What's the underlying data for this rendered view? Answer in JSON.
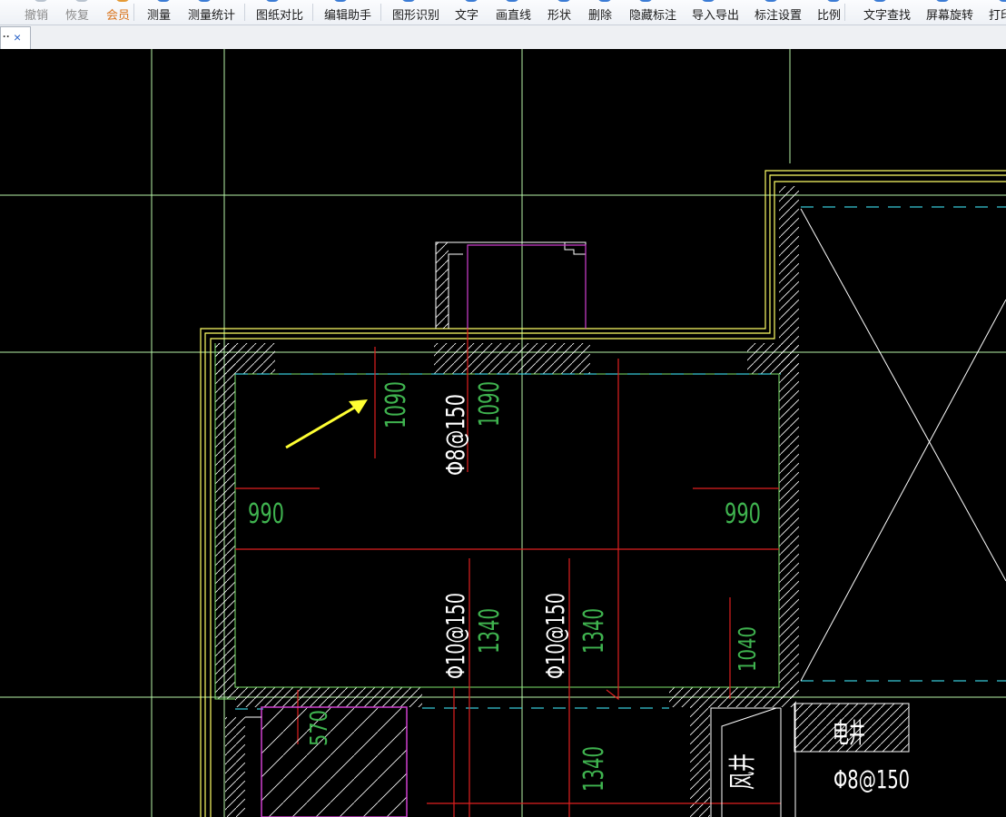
{
  "toolbar": {
    "items": [
      {
        "label": "撤销",
        "state": "disabled"
      },
      {
        "label": "恢复",
        "state": "disabled"
      },
      {
        "label": "会员",
        "state": "vip"
      },
      {
        "label": "测量"
      },
      {
        "label": "测量统计"
      },
      {
        "label": "图纸对比"
      },
      {
        "label": "编辑助手"
      },
      {
        "label": "图形识别"
      },
      {
        "label": "文字"
      },
      {
        "label": "画直线"
      },
      {
        "label": "形状"
      },
      {
        "label": "删除"
      },
      {
        "label": "隐藏标注"
      },
      {
        "label": "导入导出"
      },
      {
        "label": "标注设置"
      },
      {
        "label": "比例"
      },
      {
        "label": "文字查找"
      },
      {
        "label": "屏幕旋转"
      },
      {
        "label": "打印"
      }
    ]
  },
  "tabbar": {
    "tab_dots": "··",
    "close_glyph": "×"
  },
  "drawing": {
    "dim_top_left": "1090",
    "rebar_top": "Φ8@150",
    "dim_top_mid": "1090",
    "dim_left": "990",
    "dim_right": "990",
    "rebar_mid_1": "Φ10@150",
    "dim_mid_1": "1340",
    "rebar_mid_2": "Φ10@150",
    "dim_mid_2": "1340",
    "dim_right_low": "1040",
    "dim_bottom_left": "570",
    "dim_bottom_mid": "1340",
    "label_shaft": "电井",
    "label_wind": "风井",
    "rebar_bottom_right": "Φ8@150",
    "colors": {
      "background": "#000000",
      "wall": "#ffff66",
      "grid": "#b7f5a9",
      "rebar": "#e02020",
      "dim_text": "#3fb34f",
      "label_text": "#ffffff",
      "magenta": "#d040d0",
      "cyan": "#36c8d6",
      "arrow": "#ffff33"
    }
  }
}
